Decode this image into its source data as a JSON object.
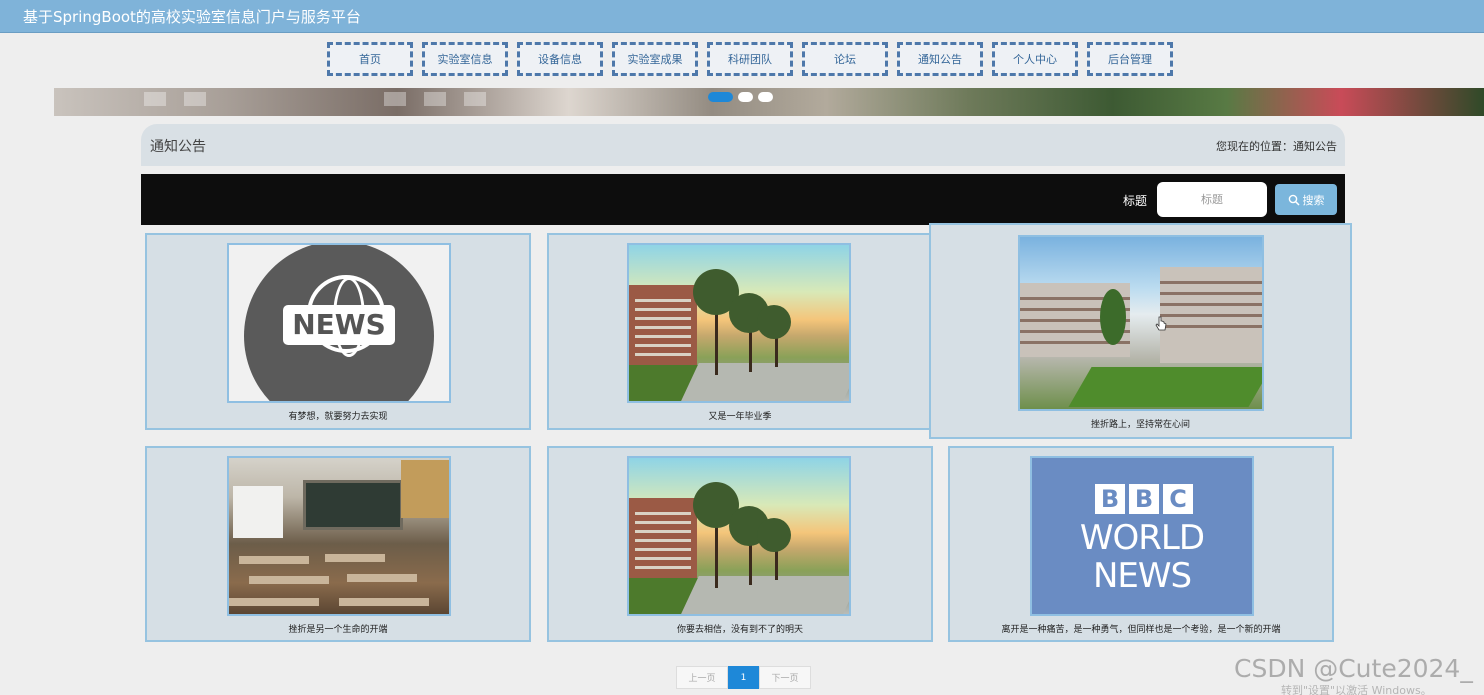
{
  "site": {
    "title": "基于SpringBoot的高校实验室信息门户与服务平台"
  },
  "nav": {
    "items": [
      {
        "label": "首页"
      },
      {
        "label": "实验室信息"
      },
      {
        "label": "设备信息"
      },
      {
        "label": "实验室成果"
      },
      {
        "label": "科研团队"
      },
      {
        "label": "论坛"
      },
      {
        "label": "通知公告"
      },
      {
        "label": "个人中心"
      },
      {
        "label": "后台管理"
      }
    ]
  },
  "carousel": {
    "dot_count": 3,
    "active_index": 0
  },
  "section": {
    "title": "通知公告",
    "breadcrumb": "您现在的位置：通知公告"
  },
  "search": {
    "label": "标题",
    "placeholder": "标题",
    "button_label": "搜索"
  },
  "news": [
    {
      "caption": "有梦想，就要努力去实现",
      "image": "news-globe"
    },
    {
      "caption": "又是一年毕业季",
      "image": "campus-sunset"
    },
    {
      "caption": "挫折路上，坚持常在心间",
      "image": "school-courtyard"
    },
    {
      "caption": "挫折是另一个生命的开端",
      "image": "classroom"
    },
    {
      "caption": "你要去相信，没有到不了的明天",
      "image": "campus-sunset"
    },
    {
      "caption": "离开是一种痛苦，是一种勇气，但同样也是一个考验，是一个新的开端",
      "image": "bbc-world-news"
    }
  ],
  "thumb_text": {
    "news": "NEWS",
    "bbc_letters": [
      "B",
      "B",
      "C"
    ],
    "bbc_line1": "WORLD",
    "bbc_line2": "NEWS"
  },
  "pagination": {
    "prev": "上一页",
    "current": "1",
    "next": "下一页"
  },
  "overlay": {
    "watermark": "CSDN @Cute2024_",
    "activate_text": "转到\"设置\"以激活 Windows。"
  },
  "colors": {
    "header": "#7fb3d9",
    "nav_border": "#4e78aa",
    "search_button": "#7bb6dc",
    "active": "#1e88d8"
  }
}
